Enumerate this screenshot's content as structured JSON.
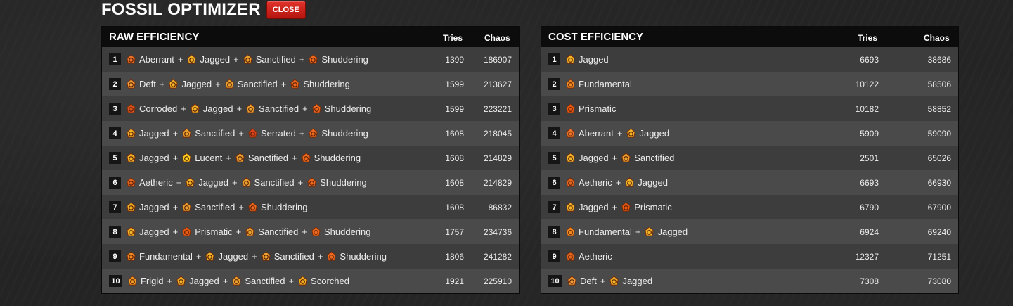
{
  "app": {
    "title": "FOSSIL OPTIMIZER",
    "close_label": "CLOSE"
  },
  "columns": {
    "tries": "Tries",
    "chaos": "Chaos"
  },
  "icon_colors": {
    "Aberrant": "#e8732a",
    "Deft": "#f2a03a",
    "Corroded": "#d9541e",
    "Jagged": "#f0b429",
    "Sanctified": "#e8a230",
    "Shuddering": "#ec6a1f",
    "Serrated": "#d8421c",
    "Lucent": "#f5d020",
    "Aetheric": "#e0651e",
    "Prismatic": "#e85a12",
    "Fundamental": "#ef8a22",
    "Frigid": "#ef9a24",
    "Scorched": "#f0b020"
  },
  "raw": {
    "title": "RAW EFFICIENCY",
    "rows": [
      {
        "rank": "1",
        "fossils": [
          "Aberrant",
          "Jagged",
          "Sanctified",
          "Shuddering"
        ],
        "tries": "1399",
        "chaos": "186907"
      },
      {
        "rank": "2",
        "fossils": [
          "Deft",
          "Jagged",
          "Sanctified",
          "Shuddering"
        ],
        "tries": "1599",
        "chaos": "213627"
      },
      {
        "rank": "3",
        "fossils": [
          "Corroded",
          "Jagged",
          "Sanctified",
          "Shuddering"
        ],
        "tries": "1599",
        "chaos": "223221"
      },
      {
        "rank": "4",
        "fossils": [
          "Jagged",
          "Sanctified",
          "Serrated",
          "Shuddering"
        ],
        "tries": "1608",
        "chaos": "218045"
      },
      {
        "rank": "5",
        "fossils": [
          "Jagged",
          "Lucent",
          "Sanctified",
          "Shuddering"
        ],
        "tries": "1608",
        "chaos": "214829"
      },
      {
        "rank": "6",
        "fossils": [
          "Aetheric",
          "Jagged",
          "Sanctified",
          "Shuddering"
        ],
        "tries": "1608",
        "chaos": "214829"
      },
      {
        "rank": "7",
        "fossils": [
          "Jagged",
          "Sanctified",
          "Shuddering"
        ],
        "tries": "1608",
        "chaos": "86832"
      },
      {
        "rank": "8",
        "fossils": [
          "Jagged",
          "Prismatic",
          "Sanctified",
          "Shuddering"
        ],
        "tries": "1757",
        "chaos": "234736"
      },
      {
        "rank": "9",
        "fossils": [
          "Fundamental",
          "Jagged",
          "Sanctified",
          "Shuddering"
        ],
        "tries": "1806",
        "chaos": "241282"
      },
      {
        "rank": "10",
        "fossils": [
          "Frigid",
          "Jagged",
          "Sanctified",
          "Scorched"
        ],
        "tries": "1921",
        "chaos": "225910"
      }
    ]
  },
  "cost": {
    "title": "COST EFFICIENCY",
    "rows": [
      {
        "rank": "1",
        "fossils": [
          "Jagged"
        ],
        "tries": "6693",
        "chaos": "38686"
      },
      {
        "rank": "2",
        "fossils": [
          "Fundamental"
        ],
        "tries": "10122",
        "chaos": "58506"
      },
      {
        "rank": "3",
        "fossils": [
          "Prismatic"
        ],
        "tries": "10182",
        "chaos": "58852"
      },
      {
        "rank": "4",
        "fossils": [
          "Aberrant",
          "Jagged"
        ],
        "tries": "5909",
        "chaos": "59090"
      },
      {
        "rank": "5",
        "fossils": [
          "Jagged",
          "Sanctified"
        ],
        "tries": "2501",
        "chaos": "65026"
      },
      {
        "rank": "6",
        "fossils": [
          "Aetheric",
          "Jagged"
        ],
        "tries": "6693",
        "chaos": "66930"
      },
      {
        "rank": "7",
        "fossils": [
          "Jagged",
          "Prismatic"
        ],
        "tries": "6790",
        "chaos": "67900"
      },
      {
        "rank": "8",
        "fossils": [
          "Fundamental",
          "Jagged"
        ],
        "tries": "6924",
        "chaos": "69240"
      },
      {
        "rank": "9",
        "fossils": [
          "Aetheric"
        ],
        "tries": "12327",
        "chaos": "71251"
      },
      {
        "rank": "10",
        "fossils": [
          "Deft",
          "Jagged"
        ],
        "tries": "7308",
        "chaos": "73080"
      }
    ]
  }
}
